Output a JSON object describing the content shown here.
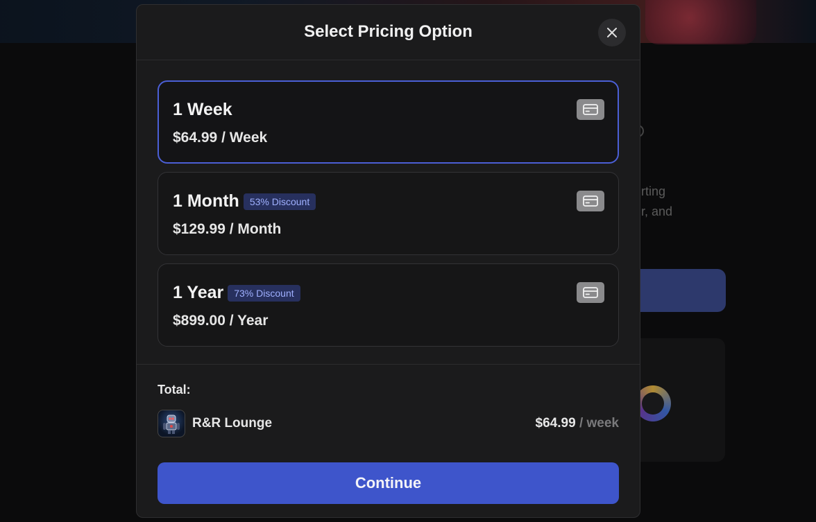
{
  "background": {
    "text_line_1": "rting",
    "text_line_2": "r, and"
  },
  "modal": {
    "title": "Select Pricing Option",
    "close_icon": "close-icon"
  },
  "options": [
    {
      "name": "1 Week",
      "badge": "",
      "price": "$64.99 / Week",
      "selected": true,
      "icon": "credit-card-icon"
    },
    {
      "name": "1 Month",
      "badge": "53% Discount",
      "price": "$129.99 / Month",
      "selected": false,
      "icon": "credit-card-icon"
    },
    {
      "name": "1 Year",
      "badge": "73% Discount",
      "price": "$899.00 / Year",
      "selected": false,
      "icon": "credit-card-icon"
    }
  ],
  "summary": {
    "total_label": "Total:",
    "product_name": "R&R Lounge",
    "price_amount": "$64.99",
    "price_period": " / week"
  },
  "continue_label": "Continue",
  "colors": {
    "accent": "#3e55cb",
    "selected_border": "#4b5fd6",
    "badge_bg": "#27305e",
    "badge_text": "#9fb0ff"
  }
}
